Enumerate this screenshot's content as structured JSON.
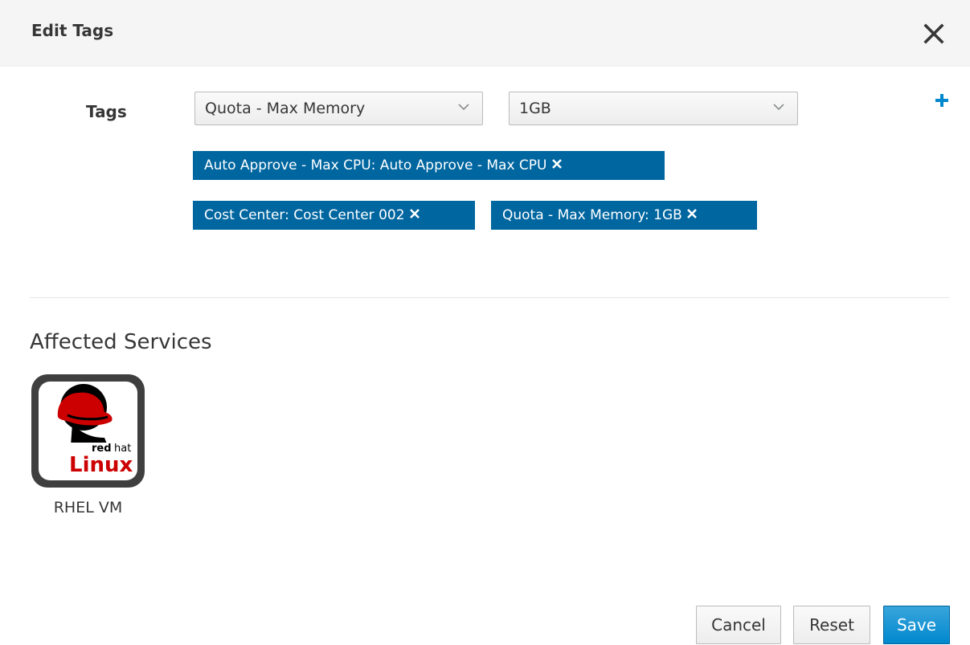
{
  "dialog": {
    "title": "Edit Tags"
  },
  "tags_row": {
    "label": "Tags",
    "category_select": {
      "value": "Quota - Max Memory"
    },
    "value_select": {
      "value": "1GB"
    }
  },
  "assigned_tags": [
    {
      "text": "Auto Approve - Max CPU: Auto Approve - Max CPU"
    },
    {
      "text": "Cost Center: Cost Center 002"
    },
    {
      "text": "Quota - Max Memory: 1GB"
    }
  ],
  "affected": {
    "title": "Affected Services",
    "services": [
      {
        "name": "RHEL VM"
      }
    ]
  },
  "buttons": {
    "cancel": "Cancel",
    "reset": "Reset",
    "save": "Save"
  },
  "colors": {
    "tag_bg": "#0066a0",
    "primary": "#0088ce",
    "header_bg": "#f5f5f5"
  },
  "logo": {
    "brand": "redhat",
    "product": "Linux"
  }
}
